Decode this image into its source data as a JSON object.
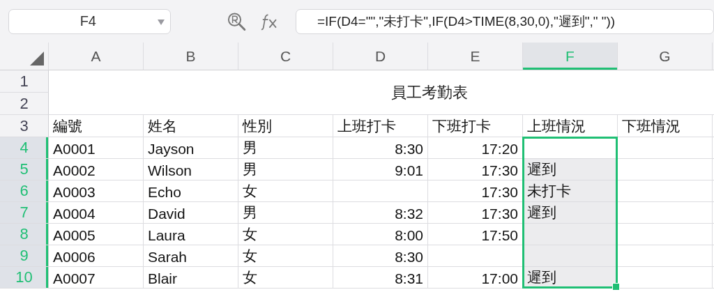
{
  "name_box": {
    "value": "F4"
  },
  "formula_bar": {
    "value": "=IF(D4=\"\",\"未打卡\",IF(D4>TIME(8,30,0),\"遲到\",\" \"))"
  },
  "columns": [
    {
      "label": "A",
      "selected": false,
      "kind": "text"
    },
    {
      "label": "B",
      "selected": false,
      "kind": "text"
    },
    {
      "label": "C",
      "selected": false,
      "kind": "text"
    },
    {
      "label": "D",
      "selected": false,
      "kind": "time"
    },
    {
      "label": "E",
      "selected": false,
      "kind": "time"
    },
    {
      "label": "F",
      "selected": true,
      "kind": "text"
    },
    {
      "label": "G",
      "selected": false,
      "kind": "text"
    }
  ],
  "title": "員工考勤表",
  "rows": [
    {
      "number": "1",
      "selected": false
    },
    {
      "number": "2",
      "selected": false
    },
    {
      "number": "3",
      "selected": false,
      "cells": [
        "編號",
        "姓名",
        "性別",
        "上班打卡",
        "下班打卡",
        "上班情況",
        "下班情況"
      ]
    },
    {
      "number": "4",
      "selected": true,
      "cells": [
        "A0001",
        "Jayson",
        "男",
        "8:30",
        "17:20",
        null,
        null
      ]
    },
    {
      "number": "5",
      "selected": true,
      "cells": [
        "A0002",
        "Wilson",
        "男",
        "9:01",
        "17:30",
        "遲到",
        null
      ]
    },
    {
      "number": "6",
      "selected": true,
      "cells": [
        "A0003",
        "Echo",
        "女",
        null,
        "17:30",
        "未打卡",
        null
      ]
    },
    {
      "number": "7",
      "selected": true,
      "cells": [
        "A0004",
        "David",
        "男",
        "8:32",
        "17:30",
        "遲到",
        null
      ]
    },
    {
      "number": "8",
      "selected": true,
      "cells": [
        "A0005",
        "Laura",
        "女",
        "8:00",
        "17:50",
        null,
        null
      ]
    },
    {
      "number": "9",
      "selected": true,
      "cells": [
        "A0006",
        "Sarah",
        "女",
        "8:30",
        null,
        null,
        null
      ]
    },
    {
      "number": "10",
      "selected": true,
      "cells": [
        "A0007",
        "Blair",
        "女",
        "8:31",
        "17:00",
        "遲到",
        null
      ]
    }
  ]
}
